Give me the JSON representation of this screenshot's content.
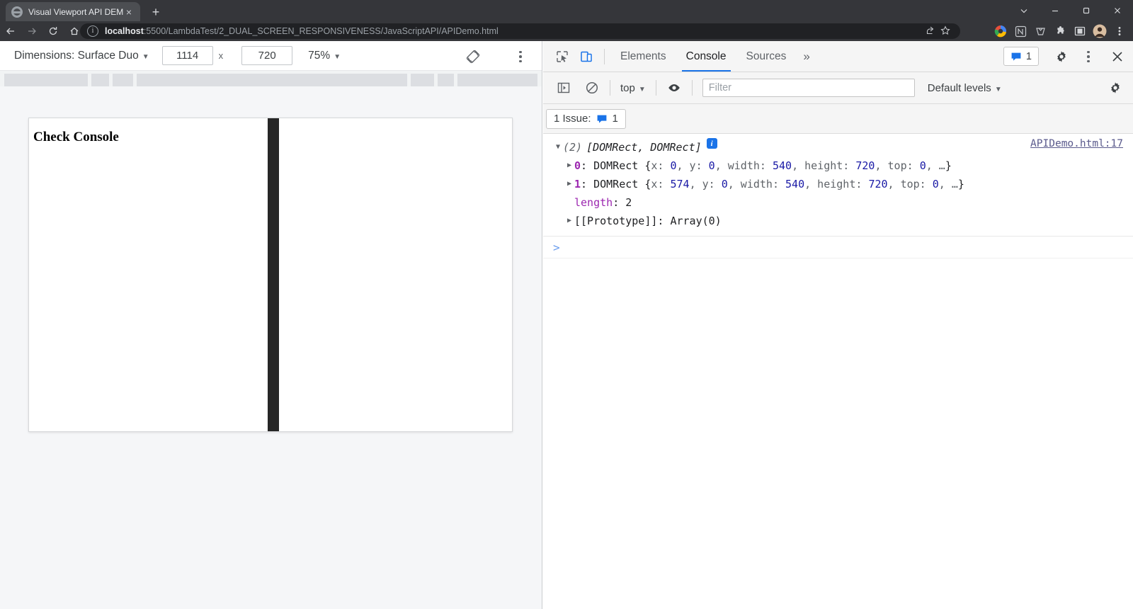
{
  "browser": {
    "tab": {
      "title": "Visual Viewport API DEMO.",
      "favicon": "globe-icon",
      "close": "×"
    },
    "new_tab_label": "+",
    "nav": {
      "back": "←",
      "forward": "→",
      "reload": "⟳",
      "home": "⌂"
    },
    "omnibox": {
      "info_glyph": "ⓘ",
      "url_bold": "localhost",
      "url_rest": ":5500/LambdaTest/2_DUAL_SCREEN_RESPONSIVENESS/JavaScriptAPI/APIDemo.html",
      "share_icon": "share-icon",
      "star_icon": "bookmark-star-icon"
    },
    "toolbar_icons": [
      "profile-circle-icon",
      "notion-icon",
      "app-icon",
      "extensions-puzzle-icon",
      "panel-icon",
      "avatar-icon",
      "chrome-menu-kebab"
    ],
    "window_controls": [
      "chevron-down",
      "minimize",
      "restore",
      "close"
    ]
  },
  "device_mode": {
    "dimensions_label": "Dimensions: Surface Duo",
    "width_value": "1114",
    "height_value": "720",
    "multiply_symbol": "x",
    "zoom_value": "75%",
    "rotate_icon": "rotate-device-icon",
    "kebab": "device-options-kebab",
    "page": {
      "heading": "Check Console"
    }
  },
  "devtools": {
    "inspect_icon": "inspect-element-icon",
    "device_toggle_icon": "toggle-device-toolbar-icon",
    "tabs": [
      {
        "label": "Elements",
        "active": false
      },
      {
        "label": "Console",
        "active": true
      },
      {
        "label": "Sources",
        "active": false
      }
    ],
    "more_tabs": "»",
    "issue_badge_count": "1",
    "settings_icon": "gear-icon",
    "kebab_icon": "devtools-menu-kebab",
    "close_icon": "close-devtools-icon",
    "console_toolbar": {
      "sidebar_icon": "console-sidebar-icon",
      "clear_icon": "clear-console-icon",
      "context": "top",
      "eye_icon": "live-expression-eye-icon",
      "filter_placeholder": "Filter",
      "filter_value": "",
      "levels": "Default levels",
      "settings_icon": "console-settings-gear-icon"
    },
    "issues_bar": {
      "text": "1 Issue:",
      "icon": "issue-message-icon",
      "count": "1"
    },
    "console": {
      "source_link": "APIDemo.html:17",
      "array_header": {
        "count": "(2)",
        "preview": "[DOMRect, DOMRect]",
        "info_badge": "i"
      },
      "rows": [
        {
          "index": "0",
          "type": "DOMRect",
          "body": "{x: 0, y: 0, width: 540, height: 720, top: 0, …}",
          "props": [
            {
              "key": "x",
              "value": "0"
            },
            {
              "key": "y",
              "value": "0"
            },
            {
              "key": "width",
              "value": "540"
            },
            {
              "key": "height",
              "value": "720"
            },
            {
              "key": "top",
              "value": "0"
            }
          ]
        },
        {
          "index": "1",
          "type": "DOMRect",
          "body": "{x: 574, y: 0, width: 540, height: 720, top: 0, …}",
          "props": [
            {
              "key": "x",
              "value": "574"
            },
            {
              "key": "y",
              "value": "0"
            },
            {
              "key": "width",
              "value": "540"
            },
            {
              "key": "height",
              "value": "720"
            },
            {
              "key": "top",
              "value": "0"
            }
          ]
        }
      ],
      "length_key": "length",
      "length_value": "2",
      "prototype_key": "[[Prototype]]",
      "prototype_value": "Array(0)",
      "prompt": ">"
    }
  },
  "colors": {
    "chrome_bg": "#35363a",
    "omnibox_bg": "#202124",
    "accent_blue": "#1a73e8",
    "devtools_bg": "#f5f5f5",
    "seam_dark": "#262626",
    "number_blue": "#1a1aa6",
    "key_purple": "#9c27b0"
  }
}
